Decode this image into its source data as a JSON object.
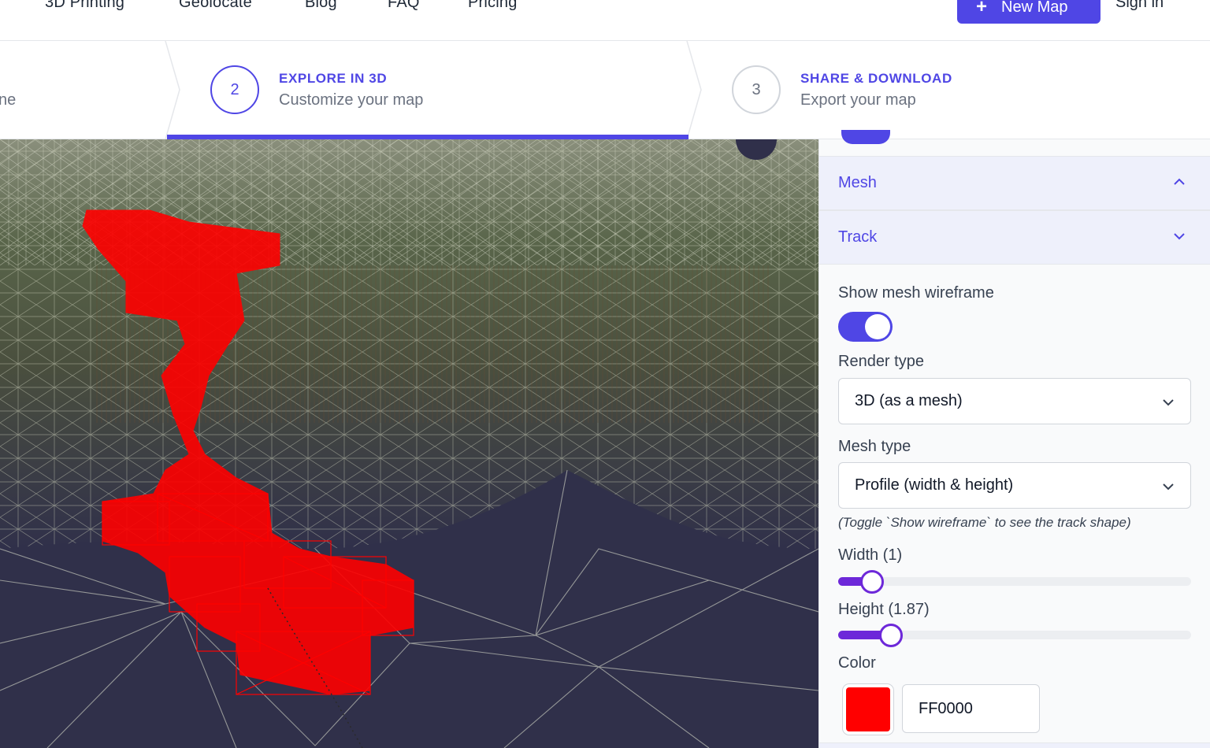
{
  "nav": {
    "links": [
      "3D Printing",
      "Geolocate",
      "Blog",
      "FAQ",
      "Pricing"
    ],
    "new_map_label": "New Map",
    "sign_in_label": "Sign in"
  },
  "steps": {
    "step1_sub_fragment": "ne",
    "step2": {
      "number": "2",
      "title": "EXPLORE IN 3D",
      "subtitle": "Customize your map"
    },
    "step3": {
      "number": "3",
      "title": "SHARE & DOWNLOAD",
      "subtitle": "Export your map"
    }
  },
  "panel": {
    "sections": [
      "Mesh",
      "Track"
    ],
    "show_wireframe_label": "Show mesh wireframe",
    "show_wireframe_on": true,
    "render_type_label": "Render type",
    "render_type_value": "3D (as a mesh)",
    "mesh_type_label": "Mesh type",
    "mesh_type_value": "Profile (width & height)",
    "mesh_hint": "(Toggle `Show wireframe` to see the track shape)",
    "width_label": "Width (1)",
    "width_fraction": 0.095,
    "height_label": "Height (1.87)",
    "height_fraction": 0.15,
    "color_label": "Color",
    "color_value": "FF0000",
    "color_hex": "#FF0000"
  },
  "colors": {
    "accent": "#4f46e5",
    "slider": "#6d28d9",
    "track": "#ff0000",
    "terrain_ground": "#30304a"
  }
}
